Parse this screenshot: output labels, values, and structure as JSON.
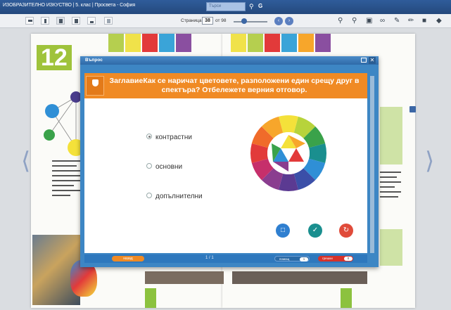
{
  "app": {
    "title": "ИЗОБРАЗИТЕЛНО ИЗКУСТВО | 5. клас | Просвета - София",
    "search_placeholder": "Търси"
  },
  "toolbar": {
    "page_label": "Страница",
    "current_page": "38",
    "total_pages": "от 98"
  },
  "book": {
    "lesson_number": "12",
    "tab_colors": [
      "#b5cf4f",
      "#f0e24a",
      "#e23a3a",
      "#3aa4d8",
      "#8a4fa0",
      "#f7a62b"
    ]
  },
  "dialog": {
    "title": "Въпрос",
    "question": "ЗаглавиеКак се наричат цветовете, разположени един срещу друг в спектъра? Отбележете верния отговор.",
    "options": [
      "контрастни",
      "основни",
      "допълнителни"
    ],
    "selected_option": 0,
    "back_label": "назад",
    "page_count": "1 / 1",
    "hint_label": "помощ",
    "hint_count": "1",
    "errors_label": "грешки",
    "errors_count": "0",
    "colors": {
      "orange": "#f08a24",
      "blue": "#2e78bd",
      "lock_btn": "#2f7fd0",
      "check_btn": "#1a8f8f",
      "reset_btn": "#e04b3a"
    }
  },
  "icons": [
    "search-icon",
    "settings-icon",
    "lock-icon",
    "key-icon",
    "reset-icon",
    "close-icon",
    "minimize-icon",
    "chevron-left-icon",
    "chevron-right-icon",
    "zoom-in-icon",
    "zoom-out-icon",
    "pen-icon",
    "save-icon",
    "eraser-icon"
  ]
}
